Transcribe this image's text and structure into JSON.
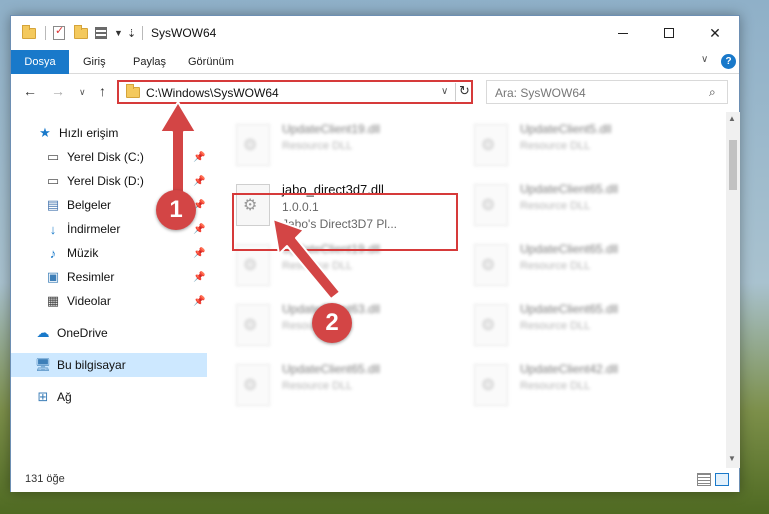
{
  "window": {
    "title": "SysWOW64",
    "controls": {
      "minimize": "minimize",
      "maximize": "maximize",
      "close": "✕"
    }
  },
  "ribbon": {
    "tabs": [
      "Dosya",
      "Giriş",
      "Paylaş",
      "Görünüm"
    ],
    "help": "?"
  },
  "navigation": {
    "address": "C:\\Windows\\SysWOW64",
    "search_placeholder": "Ara: SysWOW64"
  },
  "sidebar": {
    "items": [
      {
        "label": "Hızlı erişim",
        "icon": "star-icon",
        "pinned": false
      },
      {
        "label": "Yerel Disk (C:)",
        "icon": "drive-icon",
        "pinned": true
      },
      {
        "label": "Yerel Disk (D:)",
        "icon": "drive-icon",
        "pinned": true
      },
      {
        "label": "Belgeler",
        "icon": "document-icon",
        "pinned": true
      },
      {
        "label": "İndirmeler",
        "icon": "download-icon",
        "pinned": true
      },
      {
        "label": "Müzik",
        "icon": "music-icon",
        "pinned": true
      },
      {
        "label": "Resimler",
        "icon": "pictures-icon",
        "pinned": true
      },
      {
        "label": "Videolar",
        "icon": "video-icon",
        "pinned": true
      },
      {
        "label": "OneDrive",
        "icon": "cloud-icon",
        "pinned": false
      },
      {
        "label": "Bu bilgisayar",
        "icon": "computer-icon",
        "pinned": false,
        "selected": true
      },
      {
        "label": "Ağ",
        "icon": "network-icon",
        "pinned": false
      }
    ]
  },
  "files": {
    "background_tiles": [
      {
        "name": "UpdateClient19.dll",
        "desc": "Resource DLL"
      },
      {
        "name": "UpdateClient5.dll",
        "desc": "Resource DLL"
      },
      {
        "name": "UpdateClient65.dll",
        "desc": "Resource DLL"
      },
      {
        "name": "UpdateClient19.dll",
        "desc": "Resource DLL"
      },
      {
        "name": "UpdateClient65.dll",
        "desc": "Resource DLL"
      },
      {
        "name": "UpdateClient63.dll",
        "desc": "Resource DLL"
      },
      {
        "name": "UpdateClient65.dll",
        "desc": "Resource DLL"
      },
      {
        "name": "UpdateClient65.dll",
        "desc": "Resource DLL"
      },
      {
        "name": "UpdateClient42.dll",
        "desc": "Resource DLL"
      }
    ],
    "selected": {
      "name": "jabo_direct3d7.dll",
      "version": "1.0.0.1",
      "description": "Jabo's Direct3D7 Pl..."
    }
  },
  "status": {
    "item_count": "131 öğe"
  },
  "annotations": {
    "badge_1": "1",
    "badge_2": "2",
    "color": "#d34545"
  }
}
